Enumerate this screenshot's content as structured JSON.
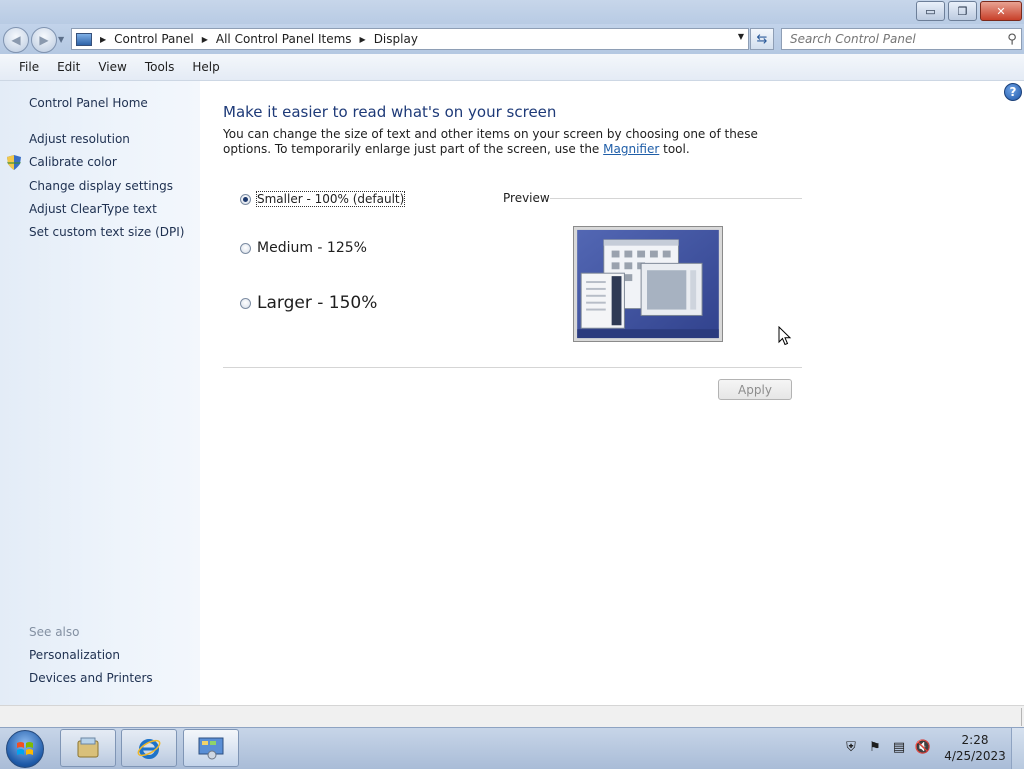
{
  "window": {
    "minimize_glyph": "▭",
    "maximize_glyph": "❐",
    "close_glyph": "✕"
  },
  "address": {
    "crumbs": [
      "Control Panel",
      "All Control Panel Items",
      "Display"
    ],
    "search_placeholder": "Search Control Panel"
  },
  "menu": {
    "file": "File",
    "edit": "Edit",
    "view": "View",
    "tools": "Tools",
    "help": "Help"
  },
  "sidebar": {
    "home": "Control Panel Home",
    "items": [
      "Adjust resolution",
      "Calibrate color",
      "Change display settings",
      "Adjust ClearType text",
      "Set custom text size (DPI)"
    ],
    "see_also_heading": "See also",
    "see_also": [
      "Personalization",
      "Devices and Printers"
    ]
  },
  "main": {
    "heading": "Make it easier to read what's on your screen",
    "desc_part1": "You can change the size of text and other items on your screen by choosing one of these options. To temporarily enlarge just part of the screen, use the",
    "desc_link": "Magnifier",
    "desc_part2": "tool.",
    "options": [
      {
        "label": "Smaller - 100% (default)",
        "selected": true
      },
      {
        "label": "Medium - 125%",
        "selected": false
      },
      {
        "label": "Larger - 150%",
        "selected": false
      }
    ],
    "preview_label": "Preview",
    "apply_label": "Apply"
  },
  "taskbar": {
    "time": "2:28",
    "date": "4/25/2023"
  },
  "colors": {
    "heading": "#1e3a78",
    "link": "#1f5ea8",
    "sidebar_bg": "#e3ecf7"
  }
}
